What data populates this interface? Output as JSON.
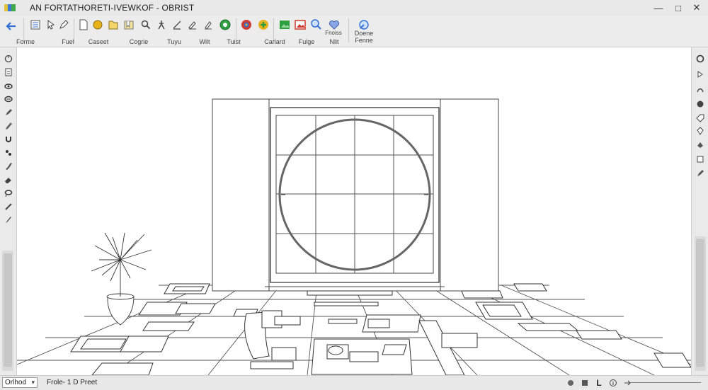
{
  "window": {
    "title": "AN FORTATHORETI-IVEWKOF - OBRIST",
    "controls": {
      "minimize": "—",
      "maximize": "□",
      "close": "✕"
    }
  },
  "toolbar": {
    "groups": [
      {
        "label": "Forme"
      },
      {
        "label": "Fuel"
      },
      {
        "label": "Caseet"
      },
      {
        "label": "Cogrie"
      },
      {
        "label": "Tuyu"
      },
      {
        "label": "Wilt"
      },
      {
        "label": "Tuist"
      },
      {
        "label": "Carlard"
      },
      {
        "label": "Fulge"
      },
      {
        "label": "Nlit"
      },
      {
        "label": "Fnoiss"
      },
      {
        "label": "Doene Fenne"
      }
    ],
    "icons": [
      "back-arrow-icon",
      "layers-icon",
      "pointer-icon",
      "pencil-icon",
      "new-document-icon",
      "sphere-icon",
      "folder-icon",
      "bookmark-icon",
      "magnifier-icon",
      "walk-icon",
      "line-tool-icon",
      "pen-tool-icon",
      "globe-settings-icon",
      "map-pin-icon",
      "emblem-icon",
      "add-scene-icon",
      "render-image-icon",
      "search-document-icon",
      "heart-icon",
      "compass-icon"
    ],
    "accent_colors": {
      "blue": "#2f6fd6",
      "green": "#2e9e3e",
      "red": "#d13a2f",
      "yellow": "#e9b21b"
    }
  },
  "left_tools": [
    "orbit-icon",
    "page-icon",
    "eye-icon",
    "view-icon",
    "brush-icon",
    "pencil-icon",
    "magnet-icon",
    "steps-icon",
    "paint-icon",
    "eraser-icon",
    "lasso-icon",
    "measure-icon",
    "knife-icon"
  ],
  "right_tools": [
    "circle-icon",
    "drag-icon",
    "curve-icon",
    "sphere-icon",
    "tag-icon",
    "pin-icon",
    "fill-icon",
    "panel-icon",
    "brush-icon"
  ],
  "status": {
    "mode_value": "Orlhod",
    "mode_options": [
      "Orlhod"
    ],
    "text": "Frole- 1 D Preet",
    "right_icons": [
      "snap-icon",
      "grid-icon",
      "ruler-icon",
      "info-icon",
      "arrow-icon"
    ],
    "right_labels": {
      "ruler": "L"
    }
  }
}
